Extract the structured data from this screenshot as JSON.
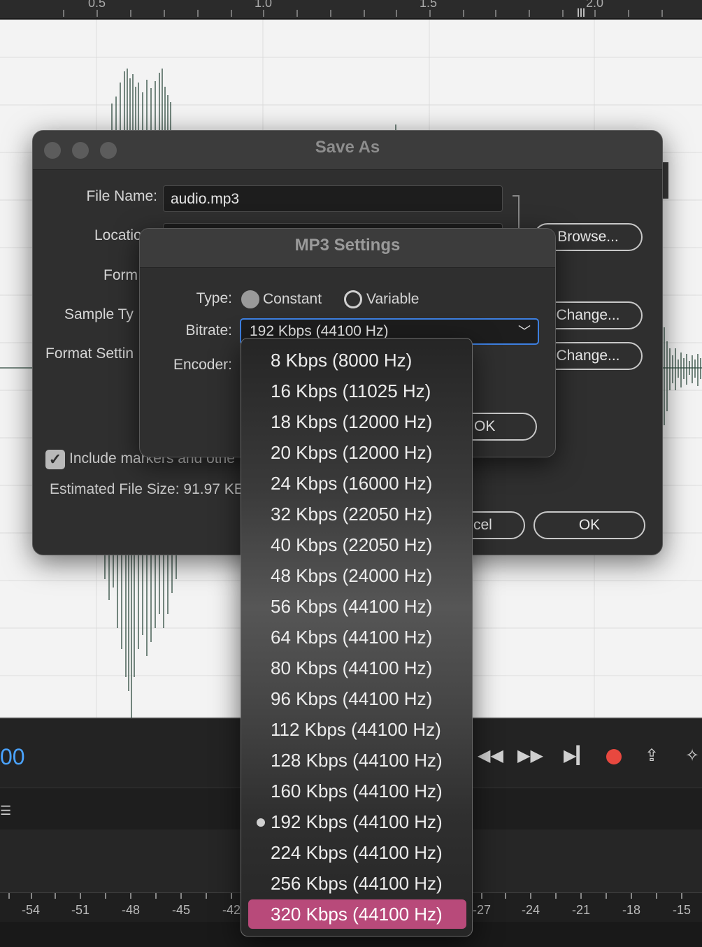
{
  "ruler": {
    "labels": [
      "0.5",
      "1.0",
      "1.5",
      "2.0"
    ]
  },
  "transport": {
    "time_suffix": "00"
  },
  "meter": {
    "labels": [
      "-54",
      "-51",
      "-48",
      "-45",
      "-42",
      "-27",
      "-24",
      "-21",
      "-18",
      "-15"
    ]
  },
  "save_as": {
    "title": "Save As",
    "file_name_label": "File Name:",
    "file_name_value": "audio.mp3",
    "location_label": "Locatio",
    "format_label": "Form",
    "sample_type_label": "Sample Ty",
    "format_settings_label": "Format Settin",
    "browse_label": "Browse...",
    "change_label_1": "Change...",
    "change_label_2": "Change...",
    "include_markers_label": "Include markers and othe",
    "include_markers_checked": true,
    "estimated_size": "Estimated File Size: 91.97 KE",
    "cancel_label": "cel",
    "ok_label": "OK"
  },
  "mp3_settings": {
    "title": "MP3 Settings",
    "type_label": "Type:",
    "type_constant": "Constant",
    "type_variable": "Variable",
    "type_selected": "Constant",
    "bitrate_label": "Bitrate:",
    "bitrate_value": "192 Kbps (44100 Hz)",
    "encoder_label": "Encoder:",
    "ok_label": "OK"
  },
  "bitrate_menu": {
    "items": [
      "8 Kbps (8000 Hz)",
      "16 Kbps (11025 Hz)",
      "18 Kbps (12000 Hz)",
      "20 Kbps (12000 Hz)",
      "24 Kbps (16000 Hz)",
      "32 Kbps (22050 Hz)",
      "40 Kbps (22050 Hz)",
      "48 Kbps (24000 Hz)",
      "56 Kbps (44100 Hz)",
      "64 Kbps (44100 Hz)",
      "80 Kbps (44100 Hz)",
      "96 Kbps (44100 Hz)",
      "112 Kbps (44100 Hz)",
      "128 Kbps (44100 Hz)",
      "160 Kbps (44100 Hz)",
      "192 Kbps (44100 Hz)",
      "224 Kbps (44100 Hz)",
      "256 Kbps (44100 Hz)",
      "320 Kbps (44100 Hz)"
    ],
    "current": "192 Kbps (44100 Hz)",
    "highlighted": "320 Kbps (44100 Hz)"
  },
  "colors": {
    "accent_blue": "#3d7fe0",
    "highlight": "#b84a7a",
    "record": "#e8483f",
    "time": "#4aa3ff"
  }
}
